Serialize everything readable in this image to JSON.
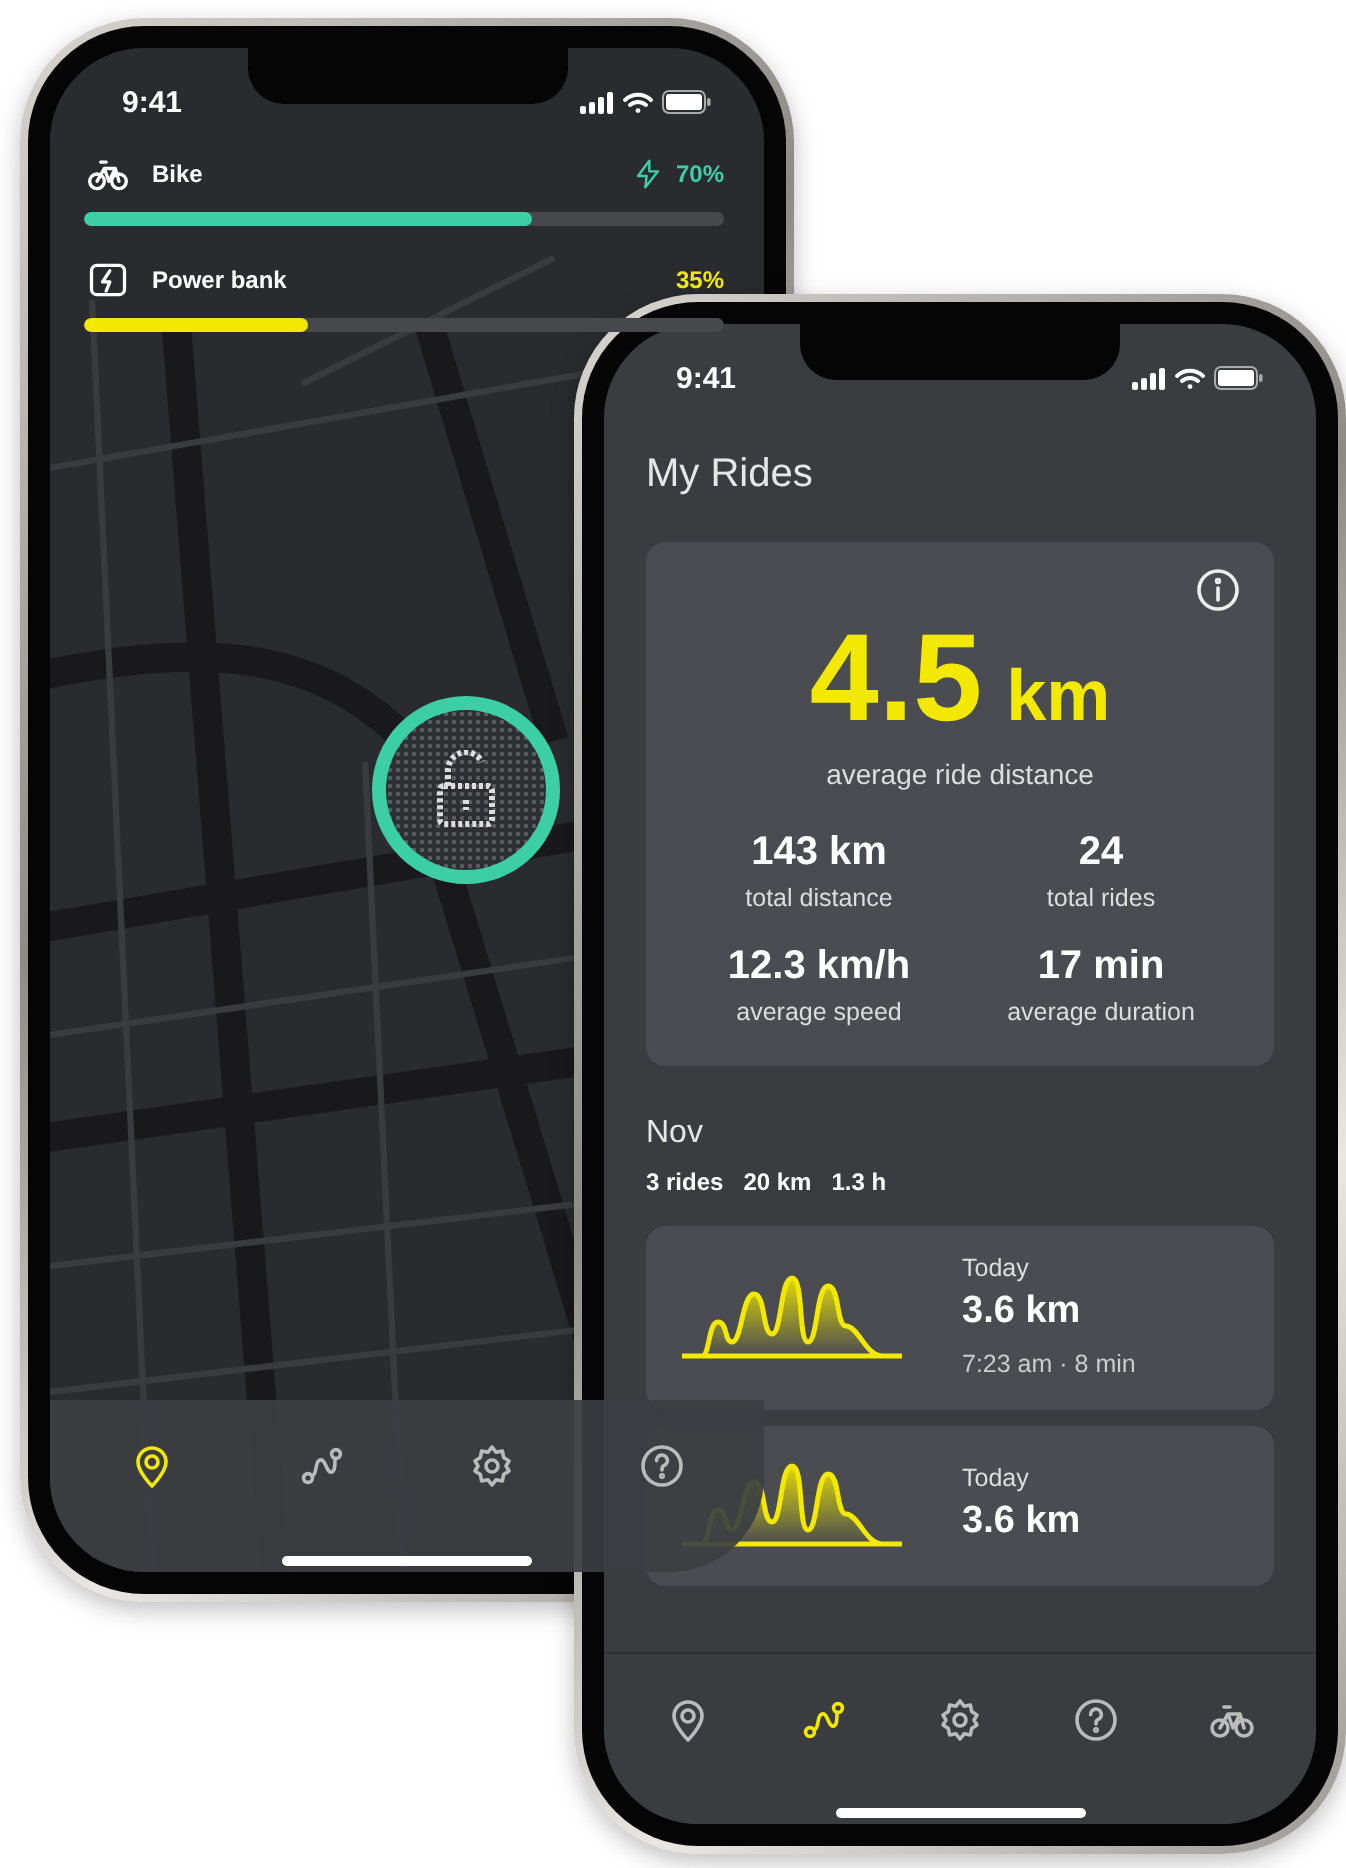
{
  "map_phone": {
    "status_time": "9:41",
    "batteries": [
      {
        "kind": "bike",
        "label": "Bike",
        "reading": "70%",
        "charging": true,
        "level": 0.7,
        "color": "#3ccfa4"
      },
      {
        "kind": "power_bank",
        "label": "Power bank",
        "reading": "35%",
        "charging": false,
        "level": 0.35,
        "color": "#f2e800"
      }
    ],
    "tabs": [
      {
        "kind": "location",
        "selected": true
      },
      {
        "kind": "route",
        "selected": false
      },
      {
        "kind": "settings",
        "selected": false
      },
      {
        "kind": "help",
        "selected": false
      }
    ]
  },
  "rides_phone": {
    "status_time": "9:41",
    "title": "My Rides",
    "summary": {
      "value": "4.5",
      "unit": "km",
      "caption": "average ride distance",
      "stats": [
        {
          "value": "143 km",
          "label": "total distance"
        },
        {
          "value": "24",
          "label": "total rides"
        },
        {
          "value": "12.3 km/h",
          "label": "average speed"
        },
        {
          "value": "17 min",
          "label": "average duration"
        }
      ]
    },
    "month": "Nov",
    "month_stats": [
      "3 rides",
      "20 km",
      "1.3 h"
    ],
    "rides": [
      {
        "date": "Today",
        "distance": "3.6 km",
        "detail": "7:23 am · 8 min"
      },
      {
        "date": "Today",
        "distance": "3.6 km"
      }
    ],
    "tabs": [
      {
        "kind": "location",
        "selected": false
      },
      {
        "kind": "route",
        "selected": true
      },
      {
        "kind": "settings",
        "selected": false
      },
      {
        "kind": "help",
        "selected": false
      },
      {
        "kind": "bike",
        "selected": false
      }
    ]
  }
}
